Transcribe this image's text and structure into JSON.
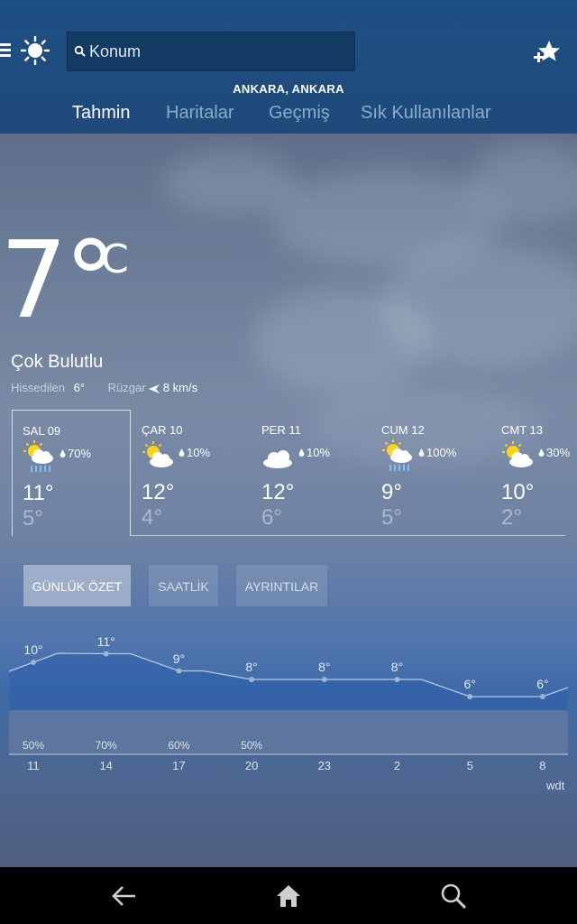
{
  "header": {
    "search_placeholder": "Konum",
    "location": "ANKARA, ANKARA",
    "tabs": [
      {
        "label": "Tahmin",
        "active": true
      },
      {
        "label": "Haritalar",
        "active": false
      },
      {
        "label": "Geçmiş",
        "active": false
      },
      {
        "label": "Sık Kullanılanlar",
        "active": false
      }
    ]
  },
  "current": {
    "temperature": "7°",
    "unit": "C",
    "condition": "Çok Bulutlu",
    "feels_like_label": "Hissedilen",
    "feels_like_value": "6°",
    "wind_label": "Rüzgar",
    "wind_value": "8 km/s"
  },
  "daily": [
    {
      "day": "SAL 09",
      "precip": "70%",
      "high": "11°",
      "low": "5°",
      "icon": "partly-sunny-rain-icon",
      "selected": true
    },
    {
      "day": "ÇAR 10",
      "precip": "10%",
      "high": "12°",
      "low": "4°",
      "icon": "partly-sunny-icon",
      "selected": false
    },
    {
      "day": "PER 11",
      "precip": "10%",
      "high": "12°",
      "low": "6°",
      "icon": "cloudy-icon",
      "selected": false
    },
    {
      "day": "CUM 12",
      "precip": "100%",
      "high": "9°",
      "low": "5°",
      "icon": "partly-sunny-rain-icon",
      "selected": false
    },
    {
      "day": "CMT 13",
      "precip": "30%",
      "high": "10°",
      "low": "2°",
      "icon": "partly-sunny-icon",
      "selected": false
    }
  ],
  "views": {
    "summary": "GÜNLÜK ÖZET",
    "hourly": "SAATLİK",
    "details": "AYRINTILAR"
  },
  "chart_data": {
    "type": "area",
    "x": [
      "11",
      "14",
      "17",
      "20",
      "23",
      "2",
      "5",
      "8"
    ],
    "temperatures": [
      10,
      11,
      9,
      8,
      8,
      8,
      6,
      6
    ],
    "temperature_labels": [
      "10°",
      "11°",
      "9°",
      "8°",
      "8°",
      "8°",
      "6°",
      "6°"
    ],
    "precipitation_labels": [
      "50%",
      "70%",
      "60%",
      "50%",
      "",
      "",
      "",
      ""
    ],
    "unit_note": "wdt"
  },
  "colors": {
    "header": "#1d4f84",
    "accent": "#ffd21f"
  },
  "navbar": {
    "icons": [
      "back-arrow-icon",
      "home-icon",
      "search-icon"
    ]
  }
}
